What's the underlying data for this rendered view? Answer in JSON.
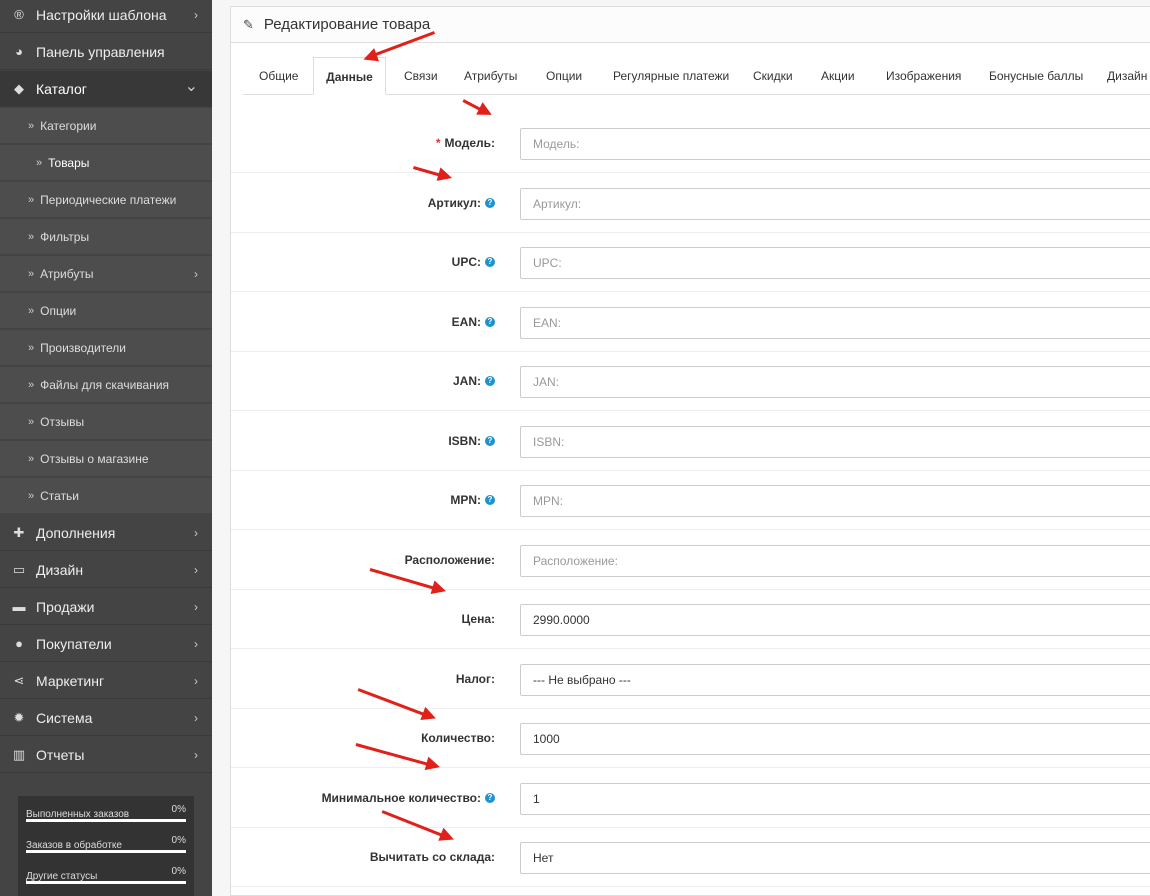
{
  "sidebar": {
    "top": [
      {
        "icon": "registered-icon",
        "label": "Настройки шаблона",
        "chevron": true
      },
      {
        "icon": "dashboard-icon",
        "label": "Панель управления",
        "chevron": false
      },
      {
        "icon": "tags-icon",
        "label": "Каталог",
        "chevron": true,
        "expanded": true
      }
    ],
    "catalog_items": [
      {
        "label": "Категории",
        "chevron": false
      },
      {
        "label": "Товары",
        "chevron": false,
        "current": true
      },
      {
        "label": "Периодические платежи",
        "chevron": false
      },
      {
        "label": "Фильтры",
        "chevron": false
      },
      {
        "label": "Атрибуты",
        "chevron": true
      },
      {
        "label": "Опции",
        "chevron": false
      },
      {
        "label": "Производители",
        "chevron": false
      },
      {
        "label": "Файлы для скачивания",
        "chevron": false
      },
      {
        "label": "Отзывы",
        "chevron": false
      },
      {
        "label": "Отзывы о магазине",
        "chevron": false
      },
      {
        "label": "Статьи",
        "chevron": false
      }
    ],
    "bottom": [
      {
        "icon": "puzzle-icon",
        "label": "Дополнения"
      },
      {
        "icon": "desktop-icon",
        "label": "Дизайн"
      },
      {
        "icon": "cart-icon",
        "label": "Продажи"
      },
      {
        "icon": "user-icon",
        "label": "Покупатели"
      },
      {
        "icon": "share-icon",
        "label": "Маркетинг"
      },
      {
        "icon": "cog-icon",
        "label": "Система"
      },
      {
        "icon": "bar-chart-icon",
        "label": "Отчеты"
      }
    ],
    "stats": [
      {
        "label": "Выполненных заказов",
        "percent": "0%"
      },
      {
        "label": "Заказов в обработке",
        "percent": "0%"
      },
      {
        "label": "Другие статусы",
        "percent": "0%"
      }
    ]
  },
  "panel": {
    "title": "Редактирование товара",
    "tabs": [
      "Общие",
      "Данные",
      "Связи",
      "Атрибуты",
      "Опции",
      "Регулярные платежи",
      "Скидки",
      "Акции",
      "Изображения",
      "Бонусные баллы",
      "Дизайн"
    ],
    "active_tab": "Данные"
  },
  "form": {
    "rows": [
      {
        "label": "Модель:",
        "required": true,
        "help": false,
        "value": "",
        "placeholder": "Модель:"
      },
      {
        "label": "Артикул:",
        "required": false,
        "help": true,
        "value": "",
        "placeholder": "Артикул:"
      },
      {
        "label": "UPC:",
        "required": false,
        "help": true,
        "value": "",
        "placeholder": "UPC:"
      },
      {
        "label": "EAN:",
        "required": false,
        "help": true,
        "value": "",
        "placeholder": "EAN:"
      },
      {
        "label": "JAN:",
        "required": false,
        "help": true,
        "value": "",
        "placeholder": "JAN:"
      },
      {
        "label": "ISBN:",
        "required": false,
        "help": true,
        "value": "",
        "placeholder": "ISBN:"
      },
      {
        "label": "MPN:",
        "required": false,
        "help": true,
        "value": "",
        "placeholder": "MPN:"
      },
      {
        "label": "Расположение:",
        "required": false,
        "help": false,
        "value": "",
        "placeholder": "Расположение:"
      },
      {
        "label": "Цена:",
        "required": false,
        "help": false,
        "value": "2990.0000",
        "placeholder": ""
      },
      {
        "label": "Налог:",
        "required": false,
        "help": false,
        "value": "--- Не выбрано ---",
        "placeholder": "",
        "select": true
      },
      {
        "label": "Количество:",
        "required": false,
        "help": false,
        "value": "1000",
        "placeholder": ""
      },
      {
        "label": "Минимальное количество:",
        "required": false,
        "help": true,
        "value": "1",
        "placeholder": ""
      },
      {
        "label": "Вычитать со склада:",
        "required": false,
        "help": false,
        "value": "Нет",
        "placeholder": "",
        "select": true
      }
    ]
  },
  "colors": {
    "sidebar_bg": "#444444",
    "help_badge": "#1e91cf",
    "required_star": "#e2302b",
    "annotation_arrow": "#e0211b"
  }
}
